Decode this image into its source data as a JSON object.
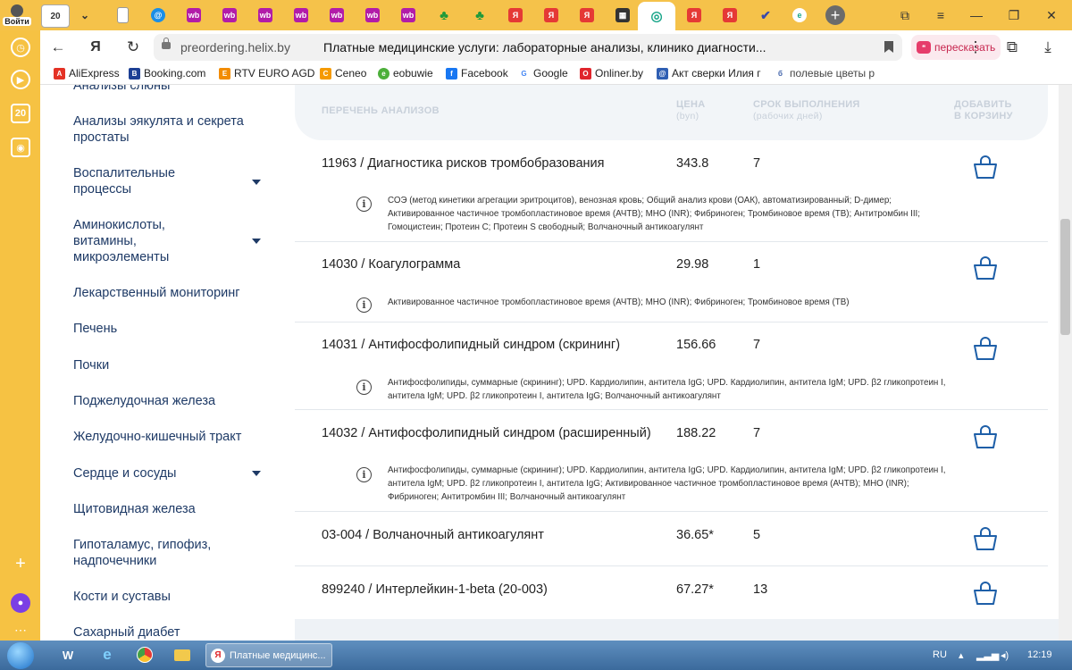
{
  "browser": {
    "profile_label": "Войти",
    "tab_counter": "20",
    "url_host": "preordering.helix.by",
    "page_title": "Платные медицинские услуги: лабораторные анализы, клинико диагности...",
    "retell_label": "пересказать"
  },
  "bookmarks": [
    {
      "label": "AliExpress",
      "color": "#e43225",
      "icon": "A"
    },
    {
      "label": "Booking.com",
      "color": "#1c3f94",
      "icon": "B"
    },
    {
      "label": "RTV EURO AGD",
      "color": "#f28c00",
      "icon": "E"
    },
    {
      "label": "Ceneo",
      "color": "#f59a00",
      "icon": "C"
    },
    {
      "label": "eobuwie",
      "color": "#4caf3a",
      "icon": "e"
    },
    {
      "label": "Facebook",
      "color": "#1877f2",
      "icon": "f"
    },
    {
      "label": "Google",
      "color": "#4285f4",
      "icon": "G"
    },
    {
      "label": "Onliner.by",
      "color": "#e0252c",
      "icon": "O"
    },
    {
      "label": "Акт сверки Илия г",
      "color": "#2f5fb3",
      "icon": "@"
    },
    {
      "label": "полевые цветы р",
      "color": "#3c5fa8",
      "icon": "б"
    }
  ],
  "sidebar_menu": [
    {
      "label": "Анализы слюны",
      "has_arrow": false
    },
    {
      "label": "Анализы эякулята и секрета простаты",
      "has_arrow": false
    },
    {
      "label": "Воспалительные процессы",
      "has_arrow": true
    },
    {
      "label": "Аминокислоты, витамины, микроэлементы",
      "has_arrow": true
    },
    {
      "label": "Лекарственный мониторинг",
      "has_arrow": false
    },
    {
      "label": "Печень",
      "has_arrow": false
    },
    {
      "label": "Почки",
      "has_arrow": false
    },
    {
      "label": "Поджелудочная железа",
      "has_arrow": false
    },
    {
      "label": "Желудочно-кишечный тракт",
      "has_arrow": false
    },
    {
      "label": "Сердце и сосуды",
      "has_arrow": true
    },
    {
      "label": "Щитовидная железа",
      "has_arrow": false
    },
    {
      "label": "Гипоталамус, гипофиз, надпочечники",
      "has_arrow": false
    },
    {
      "label": "Кости и суставы",
      "has_arrow": false
    },
    {
      "label": "Сахарный диабет",
      "has_arrow": false
    }
  ],
  "table": {
    "col_name": "ПЕРЕЧЕНЬ АНАЛИЗОВ",
    "col_price": "ЦЕНА",
    "col_price_unit": "(byn)",
    "col_term": "СРОК ВЫПОЛНЕНИЯ",
    "col_term_unit": "(рабочих дней)",
    "col_add": "ДОБАВИТЬ",
    "col_add2": "В КОРЗИНУ",
    "rows": [
      {
        "name": "11963 / Диагностика рисков тромбобразования",
        "price": "343.8",
        "days": "7",
        "desc": "СОЭ (метод кинетики агрегации эритроцитов), венозная кровь; Общий анализ крови (ОАК), автоматизированный; D-димер; Активированное частичное тромбопластиновое время (АЧТВ); МНО (INR); Фибриноген; Тромбиновое время (ТВ); Антитромбин III; Гомоцистеин; Протеин С; Протеин S свободный; Волчаночный антикоагулянт"
      },
      {
        "name": "14030 / Коагулограмма",
        "price": "29.98",
        "days": "1",
        "desc": "Активированное частичное тромбопластиновое время (АЧТВ); МНО (INR); Фибриноген; Тромбиновое время (ТВ)"
      },
      {
        "name": "14031 / Антифосфолипидный синдром (скрининг)",
        "price": "156.66",
        "days": "7",
        "desc": "Антифосфолипиды, суммарные (скрининг); UPD. Кардиолипин, антитела IgG; UPD. Кардиолипин, антитела IgM; UPD. β2 гликопротеин I, антитела IgM; UPD. β2 гликопротеин I, антитела IgG; Волчаночный антикоагулянт"
      },
      {
        "name": "14032 / Антифосфолипидный синдром (расширенный)",
        "price": "188.22",
        "days": "7",
        "desc": "Антифосфолипиды, суммарные (скрининг); UPD. Кардиолипин, антитела IgG; UPD. Кардиолипин, антитела IgM; UPD. β2 гликопротеин I, антитела IgM; UPD. β2 гликопротеин I, антитела IgG; Активированное частичное тромбопластиновое время (АЧТВ); МНО (INR); Фибриноген; Антитромбин III; Волчаночный антикоагулянт"
      },
      {
        "name": "03-004 / Волчаночный антикоагулянт",
        "price": "36.65*",
        "days": "5",
        "desc": ""
      },
      {
        "name": "899240 / Интерлейкин-1-beta (20-003)",
        "price": "67.27*",
        "days": "13",
        "desc": ""
      }
    ]
  },
  "taskbar": {
    "task_label": "Платные медицинс...",
    "lang": "RU",
    "time": "12:19"
  },
  "colors": {
    "accent": "#1e5fa8",
    "menu_text": "#1e3a66",
    "browser_chrome": "#f6c243"
  }
}
